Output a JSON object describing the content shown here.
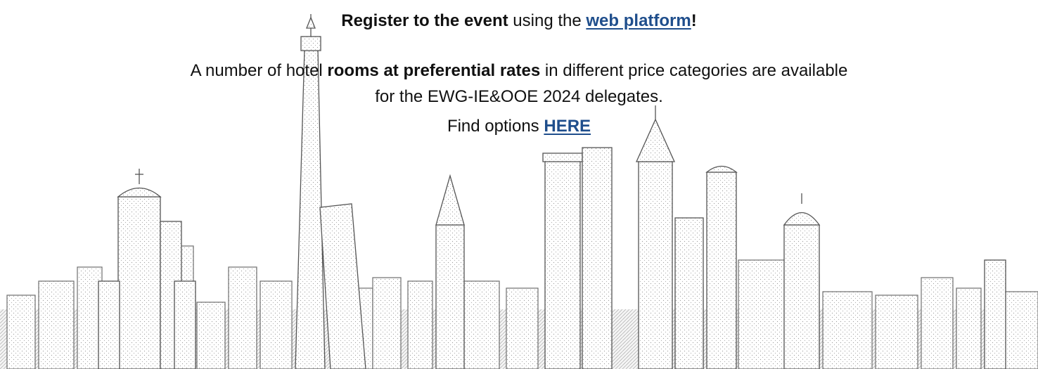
{
  "register": {
    "bold_text": "Register to the event",
    "middle_text": " using the ",
    "link_text": "web platform",
    "end_text": "!"
  },
  "hotel": {
    "intro": "A number of hotel ",
    "bold_text": "rooms at preferential rates",
    "rest": " in different price categories are available",
    "line2": "for the EWG-IE&OOE 2024 delegates."
  },
  "options": {
    "intro": "Find options ",
    "link_text": "HERE"
  },
  "colors": {
    "link": "#1f4e8c",
    "text": "#111111",
    "sketch": "#8a8a8a"
  },
  "background": {
    "illustration": "city-skyline-sketch"
  }
}
